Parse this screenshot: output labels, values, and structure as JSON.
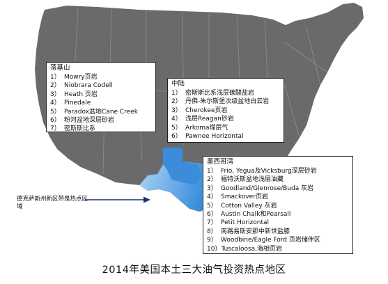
{
  "caption": "2014年美国本土三大油气投资热点地区",
  "note": "德克萨斯州新区带是热点区域",
  "colors": {
    "land": "#6a6a6c",
    "state_lines": "#8e8e90",
    "highlight_light": "#b3d9f7",
    "highlight_dark": "#3b8ddc",
    "arrow": "#1d2f7a"
  },
  "regions": [
    {
      "id": "rocky",
      "title": "落基山",
      "items": [
        {
          "num": "1）",
          "text": "Mowry页岩"
        },
        {
          "num": "2）",
          "text": "Niobrara Codell"
        },
        {
          "num": "3）",
          "text": "Heath 页岩"
        },
        {
          "num": "4）",
          "text": "Pinedale"
        },
        {
          "num": "5）",
          "text": "Paradox盆地Cane Creek"
        },
        {
          "num": "6）",
          "text": "粉河盆地深层砂岩"
        },
        {
          "num": "7）",
          "text": "密斯斯比系"
        }
      ]
    },
    {
      "id": "mid",
      "title": "中陆",
      "items": [
        {
          "num": "1）",
          "text": "密斯斯比系浅层碳酸盐岩"
        },
        {
          "num": "2）",
          "text": "丹佛-朱尔斯堡次级盆地白云岩"
        },
        {
          "num": "3）",
          "text": "Cherokee页岩"
        },
        {
          "num": "4）",
          "text": "浅层Reagan砂岩"
        },
        {
          "num": "5）",
          "text": "Arkoma煤层气"
        },
        {
          "num": "6）",
          "text": "Pawnee Horizontal"
        }
      ]
    },
    {
      "id": "gulf",
      "title": "墨西哥湾",
      "items": [
        {
          "num": "1）",
          "text": "Frio, Yegua及Vicksburg深层砂岩"
        },
        {
          "num": "2）",
          "text": "福特沃斯盆地浅层油藏"
        },
        {
          "num": "3）",
          "text": "Goodland/Glenrose/Buda 灰岩"
        },
        {
          "num": "4）",
          "text": "Smackover页岩"
        },
        {
          "num": "5）",
          "text": "Cotton Valley 灰岩"
        },
        {
          "num": "6）",
          "text": "Austin Chalk和Pearsall"
        },
        {
          "num": "7）",
          "text": "Petit Horizontal"
        },
        {
          "num": "8）",
          "text": "南路易斯安那中新世盐膝"
        },
        {
          "num": "9）",
          "text": "Woodbine/Eagle Ford 页岩储伴区"
        },
        {
          "num": "10）",
          "text": "Tuscaloosa,海相页岩"
        }
      ]
    }
  ]
}
